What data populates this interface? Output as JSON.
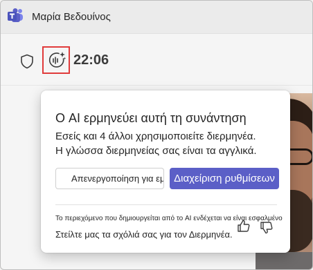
{
  "titlebar": {
    "logo_icon": "teams-logo-icon",
    "user_name": "Μαρία Βεδουίνος"
  },
  "toolbar": {
    "shield_icon": "shield-icon",
    "interpreter_icon": "ai-interpreter-sparkle-icon",
    "timer": "22:06"
  },
  "popup": {
    "title": "Ο AI ερμηνεύει αυτή τη συνάντηση",
    "body_line1": "Εσείς και 4 άλλοι χρησιμοποιείτε διερμηνέα.",
    "body_line2": "Η γλώσσα διερμηνείας σας είναι τα αγγλικά.",
    "disable_label": "Απενεργοποίηση για εμένα",
    "manage_label": "Διαχείριση ρυθμίσεων",
    "disclaimer": "Το περιεχόμενο που δημιουργείται από το AI ενδέχεται να είναι εσφαλμένο",
    "feedback": "Στείλτε μας τα σχόλιά σας για τον Διερμηνέα.",
    "thumb_up_icon": "thumb-up-icon",
    "thumb_down_icon": "thumb-down-icon"
  },
  "colors": {
    "primary": "#5b5fc7",
    "highlight_border": "#e03a3a",
    "teams_purple": "#5b5fc7"
  }
}
